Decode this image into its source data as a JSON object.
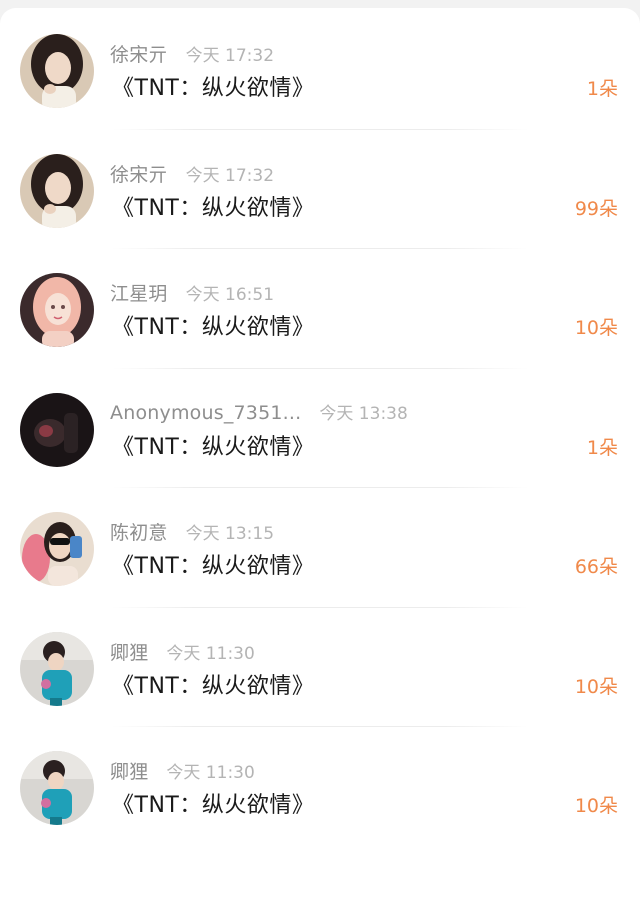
{
  "records": [
    {
      "name": "徐宋亓",
      "time": "今天 17:32",
      "gift": "《TNT：纵火欲情》",
      "count": "1朵",
      "avatar": "portrait-woman-dark-hair"
    },
    {
      "name": "徐宋亓",
      "time": "今天 17:32",
      "gift": "《TNT：纵火欲情》",
      "count": "99朵",
      "avatar": "portrait-woman-dark-hair"
    },
    {
      "name": "江星玥",
      "time": "今天 16:51",
      "gift": "《TNT：纵火欲情》",
      "count": "10朵",
      "avatar": "anime-girl-pink-hair"
    },
    {
      "name": "Anonymous_7351...",
      "time": "今天 13:38",
      "gift": "《TNT：纵火欲情》",
      "count": "1朵",
      "avatar": "dark-photo"
    },
    {
      "name": "陈初意",
      "time": "今天 13:15",
      "gift": "《TNT：纵火欲情》",
      "count": "66朵",
      "avatar": "selfie-sunglasses-pink"
    },
    {
      "name": "卿狸",
      "time": "今天 11:30",
      "gift": "《TNT：纵火欲情》",
      "count": "10朵",
      "avatar": "child-in-blue-outfit"
    },
    {
      "name": "卿狸",
      "time": "今天 11:30",
      "gift": "《TNT：纵火欲情》",
      "count": "10朵",
      "avatar": "child-in-blue-outfit"
    }
  ]
}
